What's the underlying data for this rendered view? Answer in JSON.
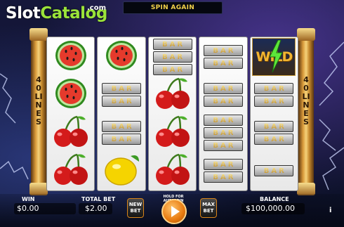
{
  "brand": {
    "logo_part1": "Slot",
    "logo_part2": "Catalog",
    "logo_suffix": ".com",
    "primary_color": "#9be33a"
  },
  "header": {
    "status_message": "SPIN AGAIN"
  },
  "paylines": {
    "left_label": "40 LINES",
    "right_label": "40 LINES"
  },
  "reels": [
    {
      "symbols": [
        "watermelon",
        "watermelon",
        "cherries",
        "cherries"
      ]
    },
    {
      "symbols": [
        "watermelon",
        "double-bar",
        "double-bar",
        "lemon"
      ]
    },
    {
      "symbols": [
        "triple-bar",
        "cherries",
        "cherries",
        "cherries"
      ]
    },
    {
      "symbols": [
        "double-bar",
        "double-bar",
        "triple-bar",
        "double-bar"
      ]
    },
    {
      "symbols": [
        "wild",
        "double-bar",
        "double-bar",
        "single-bar"
      ]
    }
  ],
  "bar_text": "BAR",
  "wild_text": "WILD",
  "footer": {
    "win_label": "WIN",
    "win_value": "$0.00",
    "total_bet_label": "TOTAL BET",
    "total_bet_value": "$2.00",
    "new_bet_label": "NEW BET",
    "hold_for_autospin_label": "HOLD FOR AUTOSPIN",
    "max_bet_label": "MAX BET",
    "balance_label": "BALANCE",
    "balance_value": "$100,000.00",
    "info_label": "i"
  },
  "icons": [
    "watermelon-icon",
    "cherries-icon",
    "lemon-icon",
    "bar-icon",
    "wild-icon",
    "spin-icon",
    "info-icon"
  ],
  "colors": {
    "accent": "#e87a0f",
    "frame_gold": "#d99a3a",
    "status_text": "#f3d24a"
  }
}
